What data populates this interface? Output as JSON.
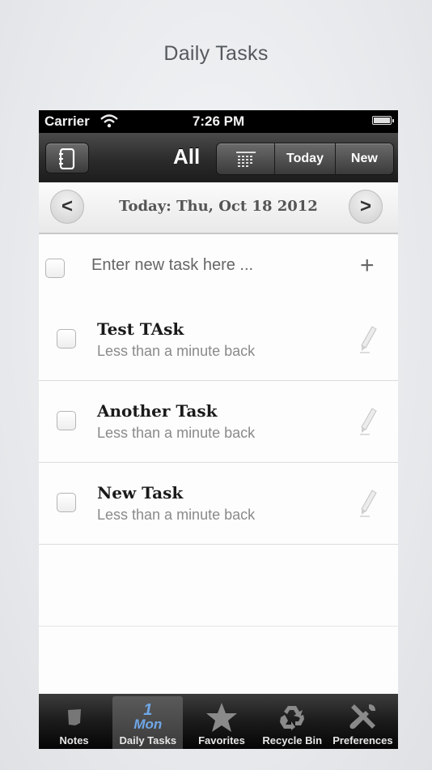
{
  "caption": "Daily Tasks",
  "status": {
    "carrier": "Carrier",
    "time": "7:26 PM"
  },
  "navbar": {
    "title": "All",
    "today_label": "Today",
    "new_label": "New"
  },
  "datebar": {
    "prev": "<",
    "next": ">",
    "date": "Today: Thu, Oct 18 2012"
  },
  "new_task": {
    "placeholder": "Enter new task here ...",
    "add": "+"
  },
  "tasks": [
    {
      "title": "Test TAsk",
      "subtitle": "Less than a minute back"
    },
    {
      "title": "Another Task",
      "subtitle": "Less than a minute back"
    },
    {
      "title": "New Task",
      "subtitle": "Less than a minute back"
    }
  ],
  "tabbar": {
    "items": [
      {
        "label": "Notes",
        "icon": "note-icon"
      },
      {
        "label": "Daily Tasks",
        "icon": "calendar-icon",
        "cal_number": "1",
        "cal_day": "Mon"
      },
      {
        "label": "Favorites",
        "icon": "star-icon"
      },
      {
        "label": "Recycle Bin",
        "icon": "recycle-icon"
      },
      {
        "label": "Preferences",
        "icon": "tools-icon"
      }
    ],
    "active": "Daily Tasks"
  },
  "colors": {
    "accent_blue": "#6fa7e8",
    "navbar": "#2b2b2b"
  }
}
